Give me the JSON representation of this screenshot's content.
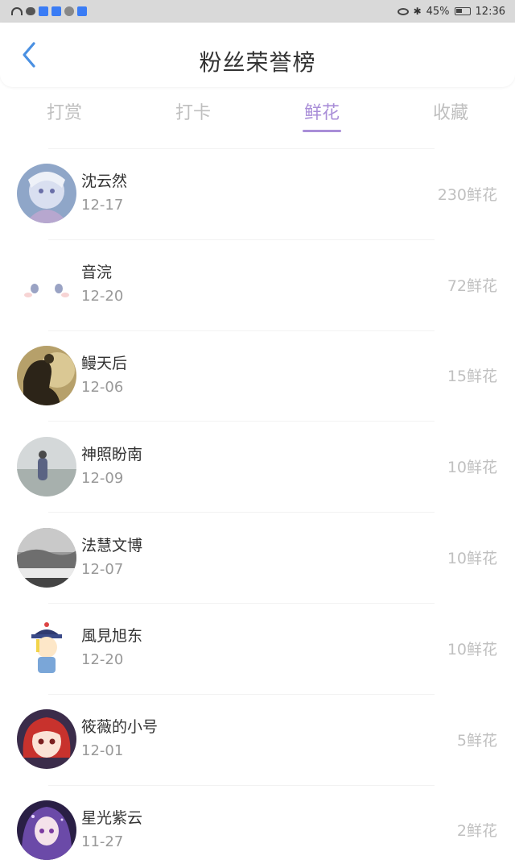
{
  "status_bar": {
    "battery": "45%",
    "time": "12:36"
  },
  "header": {
    "title": "粉丝荣誉榜"
  },
  "tabs": [
    {
      "label": "打赏",
      "active": false
    },
    {
      "label": "打卡",
      "active": false
    },
    {
      "label": "鲜花",
      "active": true
    },
    {
      "label": "收藏",
      "active": false
    }
  ],
  "fans": [
    {
      "name": "沈云然",
      "date": "12-17",
      "count": "230鲜花",
      "avatar": "anime-girl-avatar"
    },
    {
      "name": "音浣",
      "date": "12-20",
      "count": "72鲜花",
      "avatar": "cute-face-avatar"
    },
    {
      "name": "鳗天后",
      "date": "12-06",
      "count": "15鲜花",
      "avatar": "silhouette-avatar"
    },
    {
      "name": "神照盼南",
      "date": "12-09",
      "count": "10鲜花",
      "avatar": "seaside-avatar"
    },
    {
      "name": "法慧文博",
      "date": "12-07",
      "count": "10鲜花",
      "avatar": "landscape-avatar"
    },
    {
      "name": "風見旭东",
      "date": "12-20",
      "count": "10鲜花",
      "avatar": "qing-doll-avatar"
    },
    {
      "name": "筱薇的小号",
      "date": "12-01",
      "count": "5鲜花",
      "avatar": "red-hair-avatar"
    },
    {
      "name": "星光紫云",
      "date": "11-27",
      "count": "2鲜花",
      "avatar": "purple-hair-avatar"
    }
  ],
  "colors": {
    "accent": "#a98ed8",
    "count_text": "#c0c0c0"
  }
}
